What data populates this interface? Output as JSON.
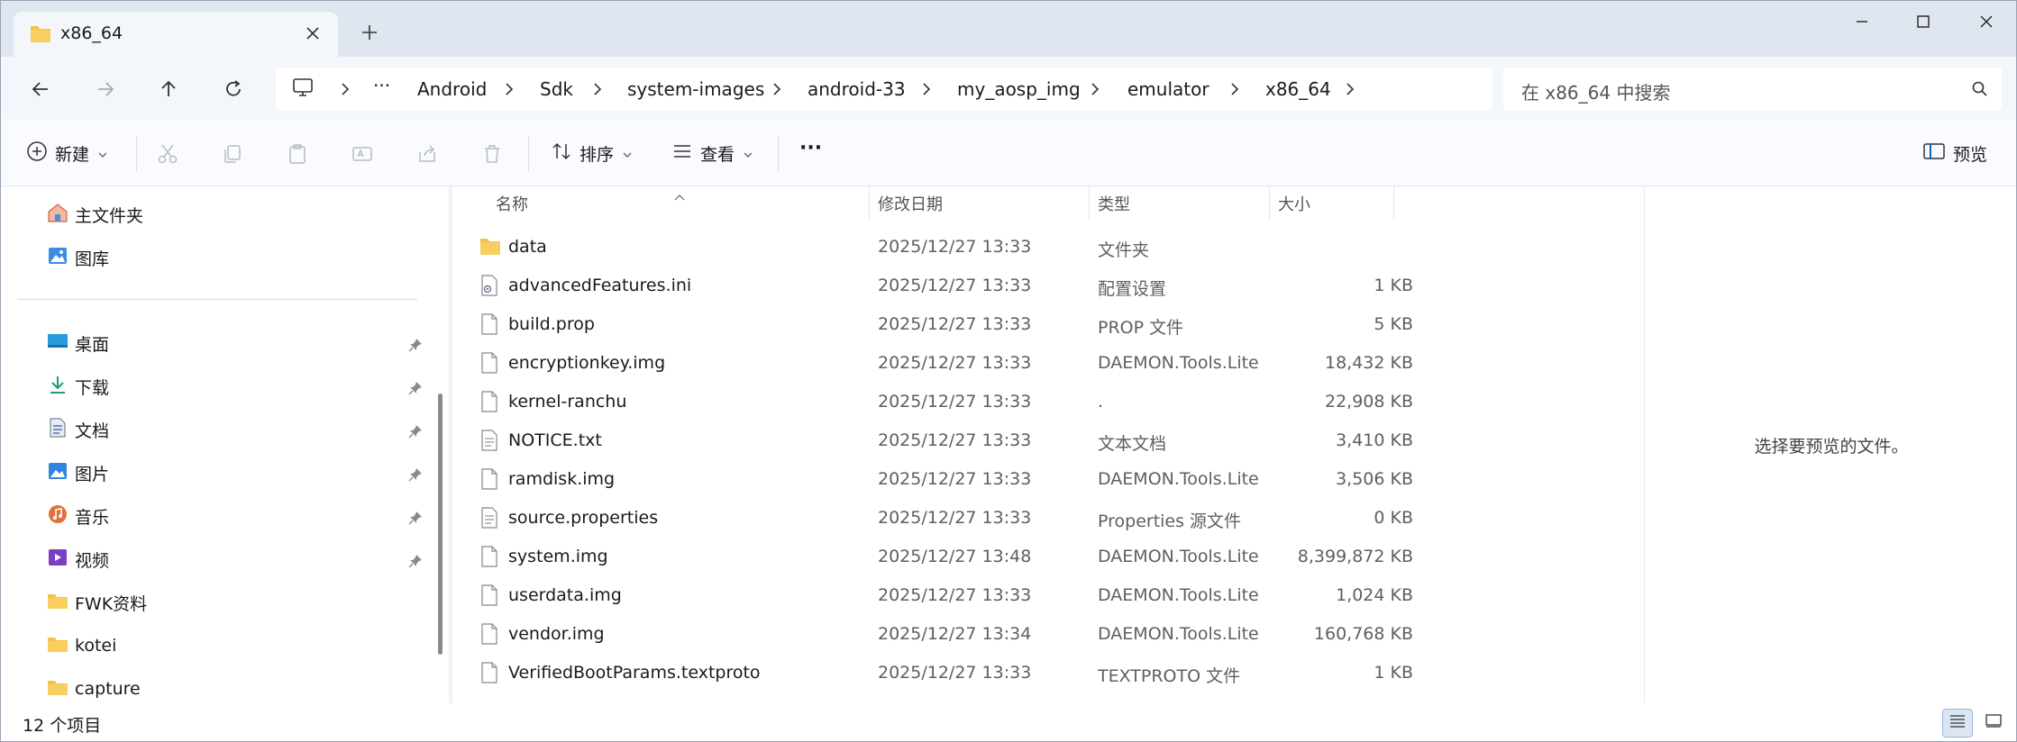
{
  "tab": {
    "title": "x86_64"
  },
  "address": {
    "more": "···",
    "crumbs": [
      "Android",
      "Sdk",
      "system-images",
      "android-33",
      "my_aosp_img",
      "emulator",
      "x86_64"
    ]
  },
  "search": {
    "placeholder": "在 x86_64 中搜索"
  },
  "toolbar": {
    "new_label": "新建",
    "sort_label": "排序",
    "view_label": "查看",
    "more_label": "···",
    "preview_label": "预览"
  },
  "sidebar": {
    "top_items": [
      {
        "label": "主文件夹",
        "icon": "home-icon"
      },
      {
        "label": "图库",
        "icon": "gallery-icon"
      }
    ],
    "items": [
      {
        "label": "桌面",
        "icon": "desktop-icon",
        "pinned": true
      },
      {
        "label": "下载",
        "icon": "download-icon",
        "pinned": true
      },
      {
        "label": "文档",
        "icon": "document-icon",
        "pinned": true
      },
      {
        "label": "图片",
        "icon": "pictures-icon",
        "pinned": true
      },
      {
        "label": "音乐",
        "icon": "music-icon",
        "pinned": true
      },
      {
        "label": "视频",
        "icon": "video-icon",
        "pinned": true
      },
      {
        "label": "FWK资料",
        "icon": "folder-icon",
        "pinned": false
      },
      {
        "label": "kotei",
        "icon": "folder-icon",
        "pinned": false
      },
      {
        "label": "capture",
        "icon": "folder-icon",
        "pinned": false
      }
    ]
  },
  "columns": {
    "name": "名称",
    "date": "修改日期",
    "type": "类型",
    "size": "大小"
  },
  "files": [
    {
      "name": "data",
      "date": "2025/12/27 13:33",
      "type": "文件夹",
      "size": "",
      "icon": "folder-icon"
    },
    {
      "name": "advancedFeatures.ini",
      "date": "2025/12/27 13:33",
      "type": "配置设置",
      "size": "1 KB",
      "icon": "settings-file-icon"
    },
    {
      "name": "build.prop",
      "date": "2025/12/27 13:33",
      "type": "PROP 文件",
      "size": "5 KB",
      "icon": "file-icon"
    },
    {
      "name": "encryptionkey.img",
      "date": "2025/12/27 13:33",
      "type": "DAEMON.Tools.Lite",
      "size": "18,432 KB",
      "icon": "file-icon"
    },
    {
      "name": "kernel-ranchu",
      "date": "2025/12/27 13:33",
      "type": ".",
      "size": "22,908 KB",
      "icon": "file-icon"
    },
    {
      "name": "NOTICE.txt",
      "date": "2025/12/27 13:33",
      "type": "文本文档",
      "size": "3,410 KB",
      "icon": "text-file-icon"
    },
    {
      "name": "ramdisk.img",
      "date": "2025/12/27 13:33",
      "type": "DAEMON.Tools.Lite",
      "size": "3,506 KB",
      "icon": "file-icon"
    },
    {
      "name": "source.properties",
      "date": "2025/12/27 13:33",
      "type": "Properties 源文件",
      "size": "0 KB",
      "icon": "text-file-icon"
    },
    {
      "name": "system.img",
      "date": "2025/12/27 13:48",
      "type": "DAEMON.Tools.Lite",
      "size": "8,399,872 KB",
      "icon": "file-icon"
    },
    {
      "name": "userdata.img",
      "date": "2025/12/27 13:33",
      "type": "DAEMON.Tools.Lite",
      "size": "1,024 KB",
      "icon": "file-icon"
    },
    {
      "name": "vendor.img",
      "date": "2025/12/27 13:34",
      "type": "DAEMON.Tools.Lite",
      "size": "160,768 KB",
      "icon": "file-icon"
    },
    {
      "name": "VerifiedBootParams.textproto",
      "date": "2025/12/27 13:33",
      "type": "TEXTPROTO 文件",
      "size": "1 KB",
      "icon": "file-icon"
    }
  ],
  "preview": {
    "message": "选择要预览的文件。"
  },
  "status": {
    "count_text": "12 个项目"
  },
  "colors": {
    "folder": "#f4c14d",
    "accent": "#0067c0",
    "titlebar": "#dfe6f0",
    "navbar": "#f3f6fb"
  }
}
